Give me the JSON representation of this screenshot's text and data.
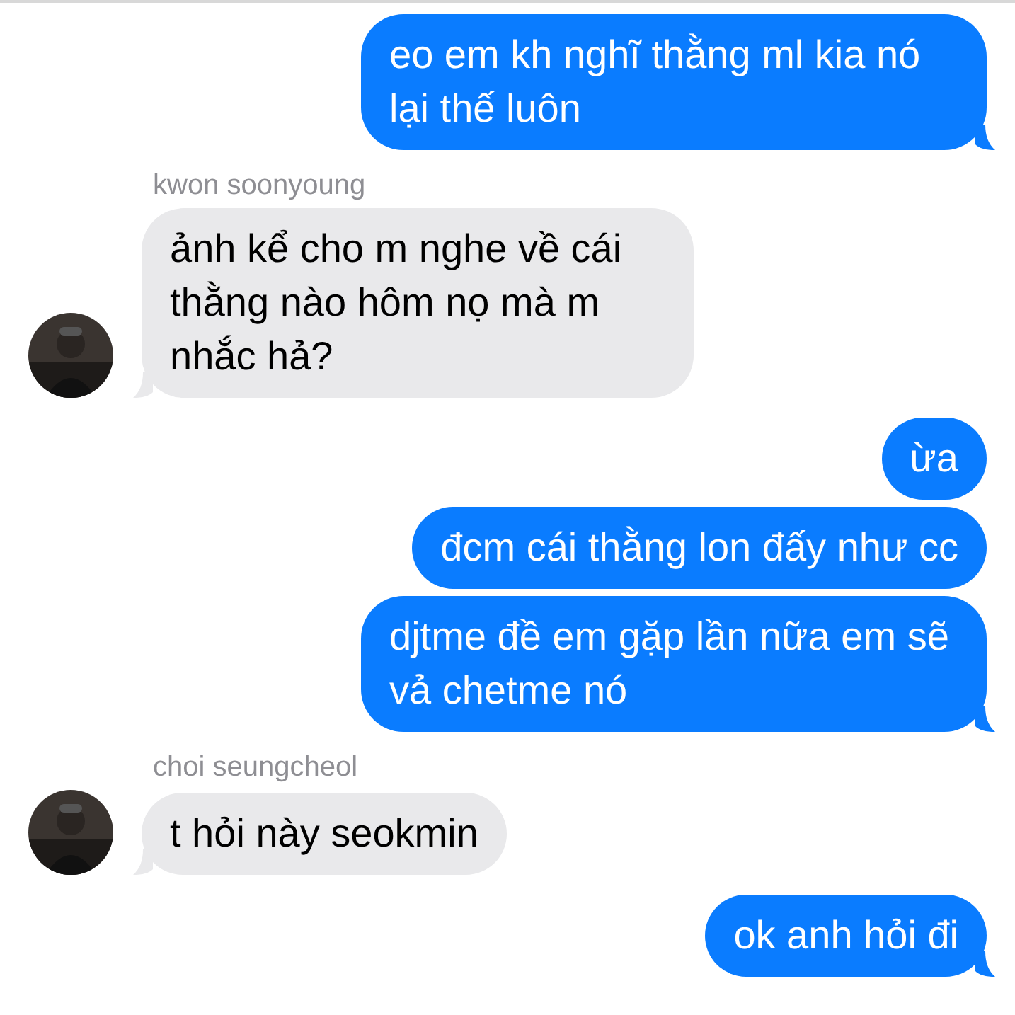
{
  "messages": [
    {
      "kind": "sent",
      "text": "eo em kh nghĩ thằng ml kia nó lại thế luôn",
      "tail": true
    },
    {
      "kind": "received",
      "sender": "kwon soonyoung",
      "text": "ảnh kể cho m nghe về cái thằng nào hôm nọ mà m nhắc hả?",
      "tail": true
    },
    {
      "kind": "sent",
      "text": "ừa",
      "tail": false
    },
    {
      "kind": "sent",
      "text": "đcm cái thằng lon đấy như cc",
      "tail": false
    },
    {
      "kind": "sent",
      "text": "djtme đề em gặp lần nữa em sẽ vả chetme nó",
      "tail": true
    },
    {
      "kind": "received",
      "sender": "choi seungcheol",
      "text": "t hỏi này seokmin",
      "tail": true
    },
    {
      "kind": "sent",
      "text": "ok anh hỏi đi",
      "tail": true
    }
  ]
}
